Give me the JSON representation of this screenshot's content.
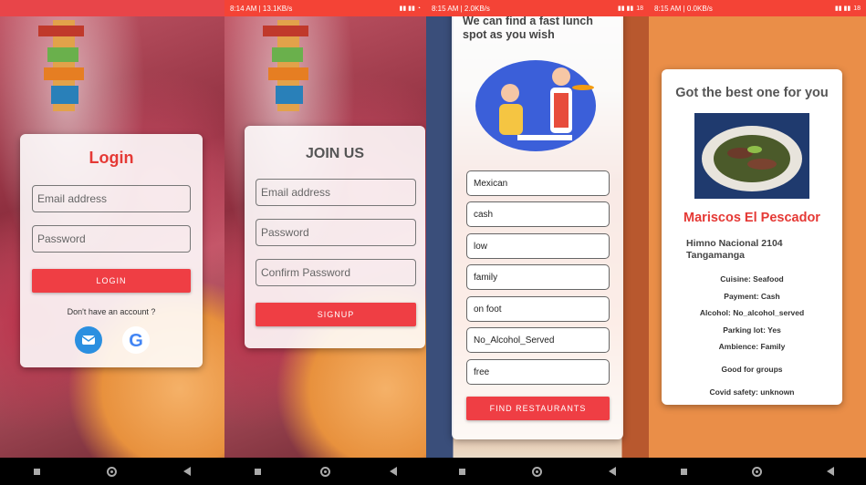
{
  "screens": [
    {
      "login": {
        "title": "Login",
        "email_placeholder": "Email address",
        "password_placeholder": "Password",
        "login_button": "LOGIN",
        "no_account": "Don't have an account ?",
        "icons": [
          "email-app-icon",
          "google-icon"
        ]
      }
    },
    {
      "status": {
        "time": "8:14 AM | 13.1KB/s",
        "battery": ""
      },
      "join": {
        "title": "JOIN US",
        "email_placeholder": "Email address",
        "password_placeholder": "Password",
        "confirm_placeholder": "Confirm Password",
        "signup_button": "SIGNUP"
      }
    },
    {
      "status": {
        "time": "8:15 AM | 2.0KB/s",
        "battery": "18"
      },
      "finder": {
        "heading": "We can find a fast lunch spot as you wish",
        "options": [
          "Mexican",
          "cash",
          "low",
          "family",
          "on foot",
          "No_Alcohol_Served",
          "free"
        ],
        "find_button": "FIND RESTAURANTS"
      }
    },
    {
      "status": {
        "time": "8:15 AM | 0.0KB/s",
        "battery": "18"
      },
      "result": {
        "heading": "Got the best one for you",
        "name": "Mariscos El Pescador",
        "address": "Himno Nacional 2104 Tangamanga",
        "details": [
          "Cuisine: Seafood",
          "Payment: Cash",
          "Alcohol: No_alcohol_served",
          "Parking lot: Yes",
          "Ambience: Family",
          "Good for groups",
          "Covid safety: unknown"
        ]
      }
    }
  ],
  "colors": {
    "accent": "#ef3e44",
    "status_bar": "#f44336",
    "result_bg": "#ea8e48"
  }
}
